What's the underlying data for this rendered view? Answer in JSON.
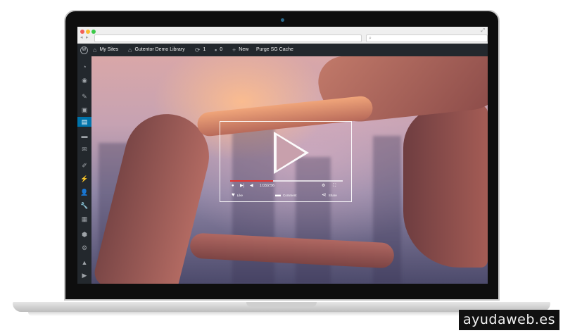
{
  "adminbar": {
    "my_sites": "My Sites",
    "site_name": "Gutentor Demo Library",
    "updates_count": "1",
    "comments_count": "0",
    "new_label": "New",
    "purge_label": "Purge SG Cache"
  },
  "sidebar": {
    "items": [
      "dashboard-icon",
      "jetpack-icon",
      "posts-icon",
      "media-icon",
      "pages-icon",
      "comments-icon",
      "contact-icon",
      "appearance-icon",
      "plugins-icon",
      "users-icon",
      "tools-icon",
      "settings-icon",
      "security-icon",
      "gear-icon",
      "performance-icon",
      "play-icon"
    ],
    "active_index": 4
  },
  "video": {
    "time": "1:03/2:56",
    "progress": 0.38,
    "like_label": "Like",
    "comment_label": "Comment",
    "share_label": "Share"
  },
  "colors": {
    "admin_bg": "#23282d",
    "active_menu": "#0073aa",
    "progress": "#e3342f"
  },
  "watermark": "ayudaweb.es"
}
